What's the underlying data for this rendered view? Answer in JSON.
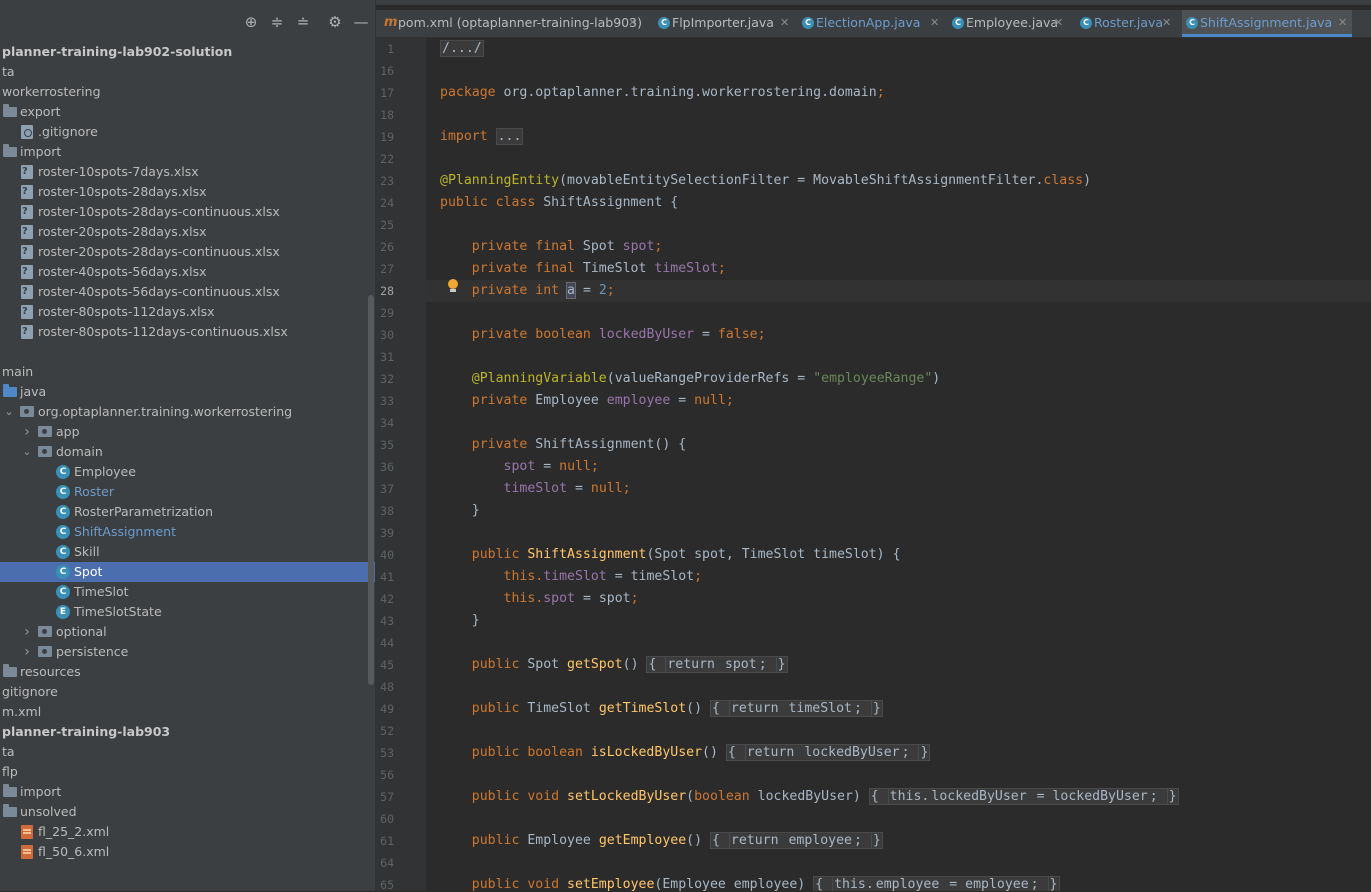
{
  "project_panel": {
    "toolbar_icons": [
      "locate-icon",
      "expand-all-icon",
      "collapse-all-icon",
      "gear-icon",
      "minimize-icon"
    ],
    "tree": [
      {
        "label": "planner-training-lab902-solution",
        "indent": -1,
        "icon": "",
        "chevron": "",
        "style": "bold"
      },
      {
        "label": "ta",
        "indent": -1,
        "icon": "",
        "chevron": "",
        "style": ""
      },
      {
        "label": "workerrostering",
        "indent": -1,
        "icon": "",
        "chevron": "",
        "style": ""
      },
      {
        "label": "export",
        "indent": 0,
        "icon": "folder",
        "chevron": "",
        "style": ""
      },
      {
        "label": ".gitignore",
        "indent": 1,
        "icon": "gitignore",
        "chevron": "",
        "style": ""
      },
      {
        "label": "import",
        "indent": 0,
        "icon": "folder",
        "chevron": "",
        "style": ""
      },
      {
        "label": "roster-10spots-7days.xlsx",
        "indent": 1,
        "icon": "xlsx",
        "chevron": "",
        "style": ""
      },
      {
        "label": "roster-10spots-28days.xlsx",
        "indent": 1,
        "icon": "xlsx",
        "chevron": "",
        "style": ""
      },
      {
        "label": "roster-10spots-28days-continuous.xlsx",
        "indent": 1,
        "icon": "xlsx",
        "chevron": "",
        "style": ""
      },
      {
        "label": "roster-20spots-28days.xlsx",
        "indent": 1,
        "icon": "xlsx",
        "chevron": "",
        "style": ""
      },
      {
        "label": "roster-20spots-28days-continuous.xlsx",
        "indent": 1,
        "icon": "xlsx",
        "chevron": "",
        "style": ""
      },
      {
        "label": "roster-40spots-56days.xlsx",
        "indent": 1,
        "icon": "xlsx",
        "chevron": "",
        "style": ""
      },
      {
        "label": "roster-40spots-56days-continuous.xlsx",
        "indent": 1,
        "icon": "xlsx",
        "chevron": "",
        "style": ""
      },
      {
        "label": "roster-80spots-112days.xlsx",
        "indent": 1,
        "icon": "xlsx",
        "chevron": "",
        "style": ""
      },
      {
        "label": "roster-80spots-112days-continuous.xlsx",
        "indent": 1,
        "icon": "xlsx",
        "chevron": "",
        "style": ""
      },
      {
        "label": "",
        "indent": -1,
        "icon": "",
        "chevron": "",
        "style": ""
      },
      {
        "label": "main",
        "indent": -1,
        "icon": "",
        "chevron": "",
        "style": ""
      },
      {
        "label": "java",
        "indent": 0,
        "icon": "folder-blue",
        "chevron": "",
        "style": ""
      },
      {
        "label": "org.optaplanner.training.workerrostering",
        "indent": 0,
        "icon": "package",
        "chevron": "down",
        "style": ""
      },
      {
        "label": "app",
        "indent": 1,
        "icon": "package",
        "chevron": "right",
        "style": ""
      },
      {
        "label": "domain",
        "indent": 1,
        "icon": "package",
        "chevron": "down",
        "style": ""
      },
      {
        "label": "Employee",
        "indent": 2,
        "icon": "class",
        "chevron": "",
        "style": ""
      },
      {
        "label": "Roster",
        "indent": 2,
        "icon": "class",
        "chevron": "",
        "style": "blue"
      },
      {
        "label": "RosterParametrization",
        "indent": 2,
        "icon": "class",
        "chevron": "",
        "style": ""
      },
      {
        "label": "ShiftAssignment",
        "indent": 2,
        "icon": "class",
        "chevron": "",
        "style": "blue"
      },
      {
        "label": "Skill",
        "indent": 2,
        "icon": "class",
        "chevron": "",
        "style": ""
      },
      {
        "label": "Spot",
        "indent": 2,
        "icon": "class",
        "chevron": "",
        "style": "selected"
      },
      {
        "label": "TimeSlot",
        "indent": 2,
        "icon": "class",
        "chevron": "",
        "style": ""
      },
      {
        "label": "TimeSlotState",
        "indent": 2,
        "icon": "enum",
        "chevron": "",
        "style": ""
      },
      {
        "label": "optional",
        "indent": 1,
        "icon": "package",
        "chevron": "right",
        "style": ""
      },
      {
        "label": "persistence",
        "indent": 1,
        "icon": "package",
        "chevron": "right",
        "style": ""
      },
      {
        "label": "resources",
        "indent": 0,
        "icon": "folder",
        "chevron": "",
        "style": ""
      },
      {
        "label": "gitignore",
        "indent": -1,
        "icon": "",
        "chevron": "",
        "style": ""
      },
      {
        "label": "m.xml",
        "indent": -1,
        "icon": "",
        "chevron": "",
        "style": ""
      },
      {
        "label": "planner-training-lab903",
        "indent": -1,
        "icon": "",
        "chevron": "",
        "style": "bold"
      },
      {
        "label": "ta",
        "indent": -1,
        "icon": "",
        "chevron": "",
        "style": ""
      },
      {
        "label": "flp",
        "indent": -1,
        "icon": "",
        "chevron": "",
        "style": ""
      },
      {
        "label": "import",
        "indent": 0,
        "icon": "folder",
        "chevron": "",
        "style": ""
      },
      {
        "label": "unsolved",
        "indent": 0,
        "icon": "folder",
        "chevron": "",
        "style": ""
      },
      {
        "label": "fl_25_2.xml",
        "indent": 1,
        "icon": "xml",
        "chevron": "",
        "style": ""
      },
      {
        "label": "fl_50_6.xml",
        "indent": 1,
        "icon": "xml",
        "chevron": "",
        "style": ""
      }
    ]
  },
  "tabs": [
    {
      "label": "pom.xml (optaplanner-training-lab903)",
      "icon": "maven",
      "active": false,
      "blue": false
    },
    {
      "label": "FlpImporter.java",
      "icon": "class",
      "active": false,
      "blue": false
    },
    {
      "label": "ElectionApp.java",
      "icon": "class",
      "active": false,
      "blue": true
    },
    {
      "label": "Employee.java",
      "icon": "class",
      "active": false,
      "blue": false
    },
    {
      "label": "Roster.java",
      "icon": "class",
      "active": false,
      "blue": true
    },
    {
      "label": "ShiftAssignment.java",
      "icon": "class",
      "active": true,
      "blue": true
    }
  ],
  "editor": {
    "current_line": "28",
    "lines": [
      {
        "n": "1",
        "fold": true,
        "tokens": [
          [
            "fold",
            "/.../"
          ]
        ]
      },
      {
        "n": "16",
        "tokens": []
      },
      {
        "n": "17",
        "tokens": [
          [
            "kw",
            "package "
          ],
          [
            "gr",
            "org.optaplanner.training.workerrostering.domain"
          ],
          [
            "kw",
            ";"
          ]
        ]
      },
      {
        "n": "18",
        "tokens": []
      },
      {
        "n": "19",
        "fold": true,
        "tokens": [
          [
            "kw",
            "import "
          ],
          [
            "fold",
            "..."
          ]
        ]
      },
      {
        "n": "22",
        "tokens": []
      },
      {
        "n": "23",
        "tokens": [
          [
            "an",
            "@PlanningEntity"
          ],
          [
            "gr",
            "(movableEntitySelectionFilter = MovableShiftAssignmentFilter."
          ],
          [
            "kw",
            "class"
          ],
          [
            "gr",
            ")"
          ]
        ]
      },
      {
        "n": "24",
        "tokens": [
          [
            "kw",
            "public class "
          ],
          [
            "gr",
            "ShiftAssignment {"
          ]
        ]
      },
      {
        "n": "25",
        "tokens": []
      },
      {
        "n": "26",
        "tokens": [
          [
            "gr",
            "    "
          ],
          [
            "kw",
            "private final "
          ],
          [
            "gr",
            "Spot "
          ],
          [
            "fd",
            "spot"
          ],
          [
            "kw",
            ";"
          ]
        ]
      },
      {
        "n": "27",
        "tokens": [
          [
            "gr",
            "    "
          ],
          [
            "kw",
            "private final "
          ],
          [
            "gr",
            "TimeSlot "
          ],
          [
            "fd",
            "timeSlot"
          ],
          [
            "kw",
            ";"
          ]
        ]
      },
      {
        "n": "28",
        "tokens": [
          [
            "gr",
            "    "
          ],
          [
            "kw",
            "private int "
          ],
          [
            "caret",
            "a"
          ],
          [
            "gr",
            " = "
          ],
          [
            "nm",
            "2"
          ],
          [
            "kw",
            ";"
          ]
        ]
      },
      {
        "n": "29",
        "tokens": []
      },
      {
        "n": "30",
        "tokens": [
          [
            "gr",
            "    "
          ],
          [
            "kw",
            "private boolean "
          ],
          [
            "fd",
            "lockedByUser"
          ],
          [
            "gr",
            " = "
          ],
          [
            "kw",
            "false;"
          ]
        ]
      },
      {
        "n": "31",
        "tokens": []
      },
      {
        "n": "32",
        "tokens": [
          [
            "gr",
            "    "
          ],
          [
            "an",
            "@PlanningVariable"
          ],
          [
            "gr",
            "(valueRangeProviderRefs = "
          ],
          [
            "st",
            "\"employeeRange\""
          ],
          [
            "gr",
            ")"
          ]
        ]
      },
      {
        "n": "33",
        "tokens": [
          [
            "gr",
            "    "
          ],
          [
            "kw",
            "private "
          ],
          [
            "gr",
            "Employee "
          ],
          [
            "fd",
            "employee"
          ],
          [
            "gr",
            " = "
          ],
          [
            "kw",
            "null;"
          ]
        ]
      },
      {
        "n": "34",
        "tokens": []
      },
      {
        "n": "35",
        "fold": true,
        "tokens": [
          [
            "gr",
            "    "
          ],
          [
            "kw",
            "private "
          ],
          [
            "gr",
            "ShiftAssignment() {"
          ]
        ]
      },
      {
        "n": "36",
        "tokens": [
          [
            "gr",
            "        "
          ],
          [
            "fd",
            "spot"
          ],
          [
            "gr",
            " = "
          ],
          [
            "kw",
            "null;"
          ]
        ]
      },
      {
        "n": "37",
        "tokens": [
          [
            "gr",
            "        "
          ],
          [
            "fd",
            "timeSlot"
          ],
          [
            "gr",
            " = "
          ],
          [
            "kw",
            "null;"
          ]
        ]
      },
      {
        "n": "38",
        "fold": true,
        "tokens": [
          [
            "gr",
            "    }"
          ]
        ]
      },
      {
        "n": "39",
        "tokens": []
      },
      {
        "n": "40",
        "fold": true,
        "tokens": [
          [
            "gr",
            "    "
          ],
          [
            "kw",
            "public "
          ],
          [
            "mt",
            "ShiftAssignment"
          ],
          [
            "gr",
            "(Spot spot, TimeSlot timeSlot) {"
          ]
        ]
      },
      {
        "n": "41",
        "tokens": [
          [
            "gr",
            "        "
          ],
          [
            "kw",
            "this."
          ],
          [
            "fd",
            "timeSlot"
          ],
          [
            "gr",
            " = timeSlot"
          ],
          [
            "kw",
            ";"
          ]
        ]
      },
      {
        "n": "42",
        "tokens": [
          [
            "gr",
            "        "
          ],
          [
            "kw",
            "this."
          ],
          [
            "fd",
            "spot"
          ],
          [
            "gr",
            " = spot"
          ],
          [
            "kw",
            ";"
          ]
        ]
      },
      {
        "n": "43",
        "fold": true,
        "tokens": [
          [
            "gr",
            "    }"
          ]
        ]
      },
      {
        "n": "44",
        "tokens": []
      },
      {
        "n": "45",
        "fold": true,
        "tokens": [
          [
            "gr",
            "    "
          ],
          [
            "kw",
            "public "
          ],
          [
            "gr",
            "Spot "
          ],
          [
            "mt",
            "getSpot"
          ],
          [
            "gr",
            "() "
          ],
          [
            "fold",
            "{ "
          ],
          [
            "foldkw",
            "return "
          ],
          [
            "foldfd",
            "spot"
          ],
          [
            "foldkw",
            "; "
          ],
          [
            "fold",
            "}"
          ]
        ]
      },
      {
        "n": "48",
        "tokens": []
      },
      {
        "n": "49",
        "fold": true,
        "tokens": [
          [
            "gr",
            "    "
          ],
          [
            "kw",
            "public "
          ],
          [
            "gr",
            "TimeSlot "
          ],
          [
            "mt",
            "getTimeSlot"
          ],
          [
            "gr",
            "() "
          ],
          [
            "fold",
            "{ "
          ],
          [
            "foldkw",
            "return "
          ],
          [
            "foldfd",
            "timeSlot"
          ],
          [
            "foldkw",
            "; "
          ],
          [
            "fold",
            "}"
          ]
        ]
      },
      {
        "n": "52",
        "tokens": []
      },
      {
        "n": "53",
        "fold": true,
        "tokens": [
          [
            "gr",
            "    "
          ],
          [
            "kw",
            "public boolean "
          ],
          [
            "mt",
            "isLockedByUser"
          ],
          [
            "gr",
            "() "
          ],
          [
            "fold",
            "{ "
          ],
          [
            "foldkw",
            "return "
          ],
          [
            "foldfd",
            "lockedByUser"
          ],
          [
            "foldkw",
            "; "
          ],
          [
            "fold",
            "}"
          ]
        ]
      },
      {
        "n": "56",
        "tokens": []
      },
      {
        "n": "57",
        "fold": true,
        "tokens": [
          [
            "gr",
            "    "
          ],
          [
            "kw",
            "public void "
          ],
          [
            "mt",
            "setLockedByUser"
          ],
          [
            "gr",
            "("
          ],
          [
            "kw",
            "boolean "
          ],
          [
            "gr",
            "lockedByUser) "
          ],
          [
            "fold",
            "{ "
          ],
          [
            "foldkw",
            "this."
          ],
          [
            "foldfd",
            "lockedByUser"
          ],
          [
            "foldgr",
            " = lockedByUser"
          ],
          [
            "foldkw",
            "; "
          ],
          [
            "fold",
            "}"
          ]
        ]
      },
      {
        "n": "60",
        "tokens": []
      },
      {
        "n": "61",
        "fold": true,
        "tokens": [
          [
            "gr",
            "    "
          ],
          [
            "kw",
            "public "
          ],
          [
            "gr",
            "Employee "
          ],
          [
            "mt",
            "getEmployee"
          ],
          [
            "gr",
            "() "
          ],
          [
            "fold",
            "{ "
          ],
          [
            "foldkw",
            "return "
          ],
          [
            "foldfd",
            "employee"
          ],
          [
            "foldkw",
            "; "
          ],
          [
            "fold",
            "}"
          ]
        ]
      },
      {
        "n": "64",
        "tokens": []
      },
      {
        "n": "65",
        "fold": true,
        "tokens": [
          [
            "gr",
            "    "
          ],
          [
            "kw",
            "public void "
          ],
          [
            "mt",
            "setEmployee"
          ],
          [
            "gr",
            "(Employee employee) "
          ],
          [
            "fold",
            "{ "
          ],
          [
            "foldkw",
            "this."
          ],
          [
            "foldfd",
            "employee"
          ],
          [
            "foldgr",
            " = employee"
          ],
          [
            "foldkw",
            "; "
          ],
          [
            "fold",
            "}"
          ]
        ]
      }
    ]
  }
}
